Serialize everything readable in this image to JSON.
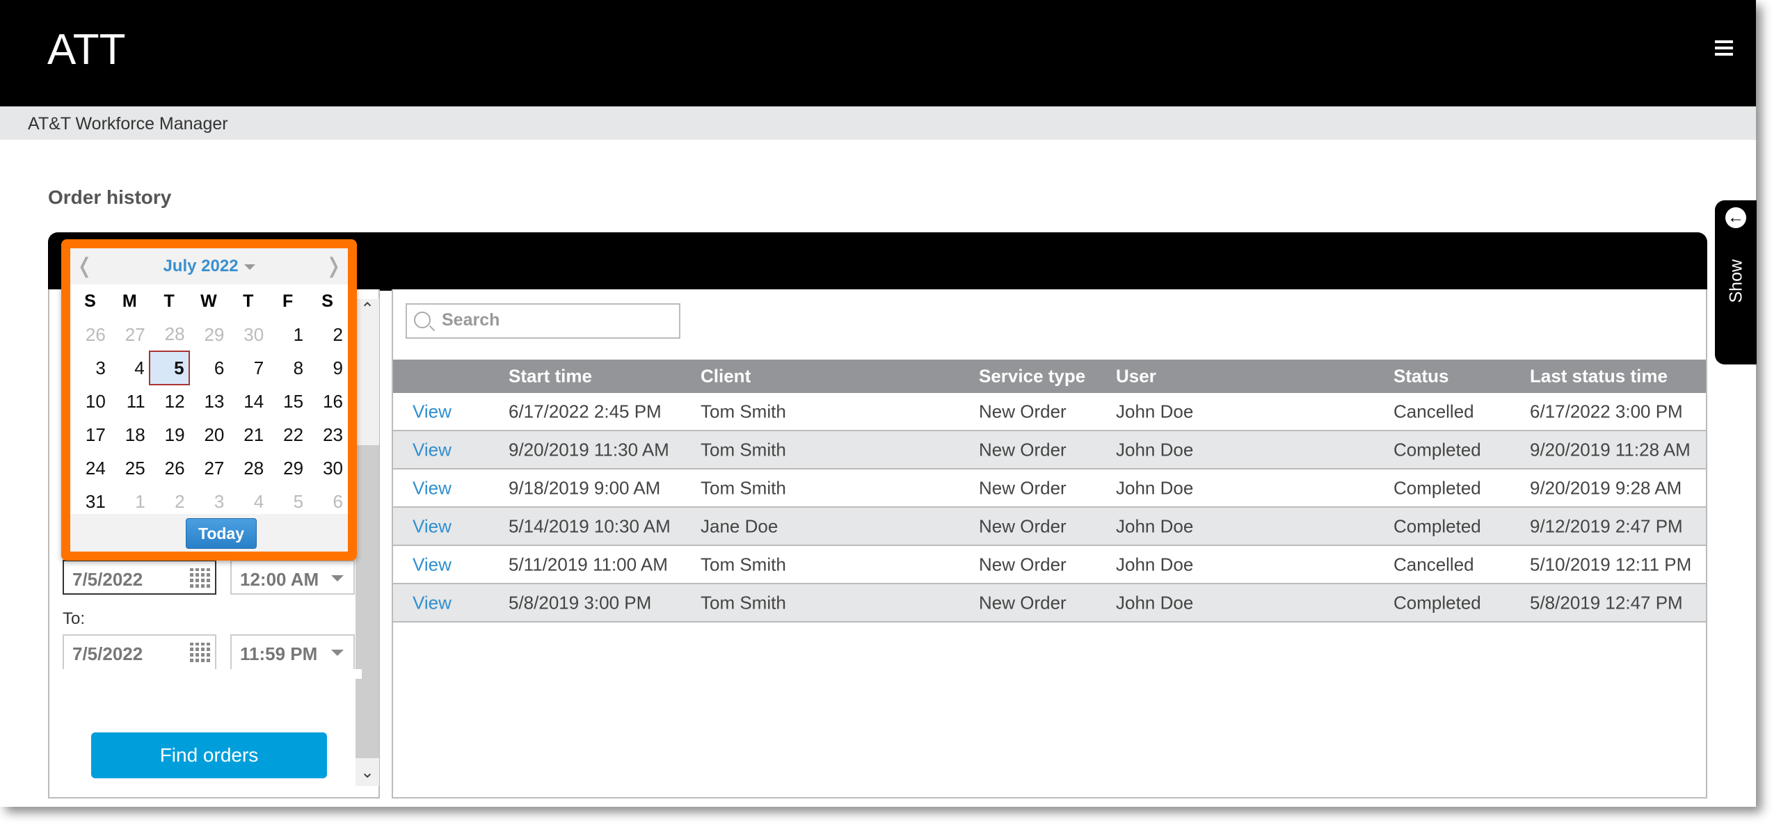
{
  "header": {
    "brand": "ATT",
    "subtitle": "AT&T Workforce Manager",
    "menu_icon": "hamburger-icon"
  },
  "page": {
    "title": "Order history"
  },
  "show_tab": {
    "label": "Show",
    "icon": "arrow-left-circle-icon"
  },
  "calendar": {
    "month_label": "July 2022",
    "prev": "❬",
    "next": "❭",
    "weekdays": [
      "S",
      "M",
      "T",
      "W",
      "T",
      "F",
      "S"
    ],
    "weeks": [
      [
        {
          "d": "26",
          "o": true
        },
        {
          "d": "27",
          "o": true
        },
        {
          "d": "28",
          "o": true
        },
        {
          "d": "29",
          "o": true
        },
        {
          "d": "30",
          "o": true
        },
        {
          "d": "1"
        },
        {
          "d": "2"
        }
      ],
      [
        {
          "d": "3"
        },
        {
          "d": "4"
        },
        {
          "d": "5",
          "sel": true
        },
        {
          "d": "6"
        },
        {
          "d": "7"
        },
        {
          "d": "8"
        },
        {
          "d": "9"
        }
      ],
      [
        {
          "d": "10"
        },
        {
          "d": "11"
        },
        {
          "d": "12"
        },
        {
          "d": "13"
        },
        {
          "d": "14"
        },
        {
          "d": "15"
        },
        {
          "d": "16"
        }
      ],
      [
        {
          "d": "17"
        },
        {
          "d": "18"
        },
        {
          "d": "19"
        },
        {
          "d": "20"
        },
        {
          "d": "21"
        },
        {
          "d": "22"
        },
        {
          "d": "23"
        }
      ],
      [
        {
          "d": "24"
        },
        {
          "d": "25"
        },
        {
          "d": "26"
        },
        {
          "d": "27"
        },
        {
          "d": "28"
        },
        {
          "d": "29"
        },
        {
          "d": "30"
        }
      ],
      [
        {
          "d": "31"
        },
        {
          "d": "1",
          "o": true
        },
        {
          "d": "2",
          "o": true
        },
        {
          "d": "3",
          "o": true
        },
        {
          "d": "4",
          "o": true
        },
        {
          "d": "5",
          "o": true
        },
        {
          "d": "6",
          "o": true
        }
      ]
    ],
    "today_label": "Today",
    "accent": "#ff7200"
  },
  "filters": {
    "from_date": "7/5/2022",
    "from_time": "12:00 AM",
    "to_label": "To:",
    "to_date": "7/5/2022",
    "to_time": "11:59 PM",
    "find_label": "Find orders"
  },
  "search": {
    "placeholder": "Search"
  },
  "table": {
    "headers": [
      "",
      "Start time",
      "Client",
      "Service type",
      "User",
      "Status",
      "Last status time"
    ],
    "rows": [
      [
        "View",
        "6/17/2022 2:45 PM",
        "Tom Smith",
        "New Order",
        "John Doe",
        "Cancelled",
        "6/17/2022 3:00 PM"
      ],
      [
        "View",
        "9/20/2019 11:30 AM",
        "Tom Smith",
        "New Order",
        "John Doe",
        "Completed",
        "9/20/2019 11:28 AM"
      ],
      [
        "View",
        "9/18/2019 9:00 AM",
        "Tom Smith",
        "New Order",
        "John Doe",
        "Completed",
        "9/20/2019 9:28 AM"
      ],
      [
        "View",
        "5/14/2019 10:30 AM",
        "Jane Doe",
        "New Order",
        "John Doe",
        "Completed",
        "9/12/2019 2:47 PM"
      ],
      [
        "View",
        "5/11/2019 11:00 AM",
        "Tom Smith",
        "New Order",
        "John Doe",
        "Cancelled",
        "5/10/2019 12:11 PM"
      ],
      [
        "View",
        "5/8/2019 3:00 PM",
        "Tom Smith",
        "New Order",
        "John Doe",
        "Completed",
        "5/8/2019 12:47 PM"
      ]
    ]
  }
}
